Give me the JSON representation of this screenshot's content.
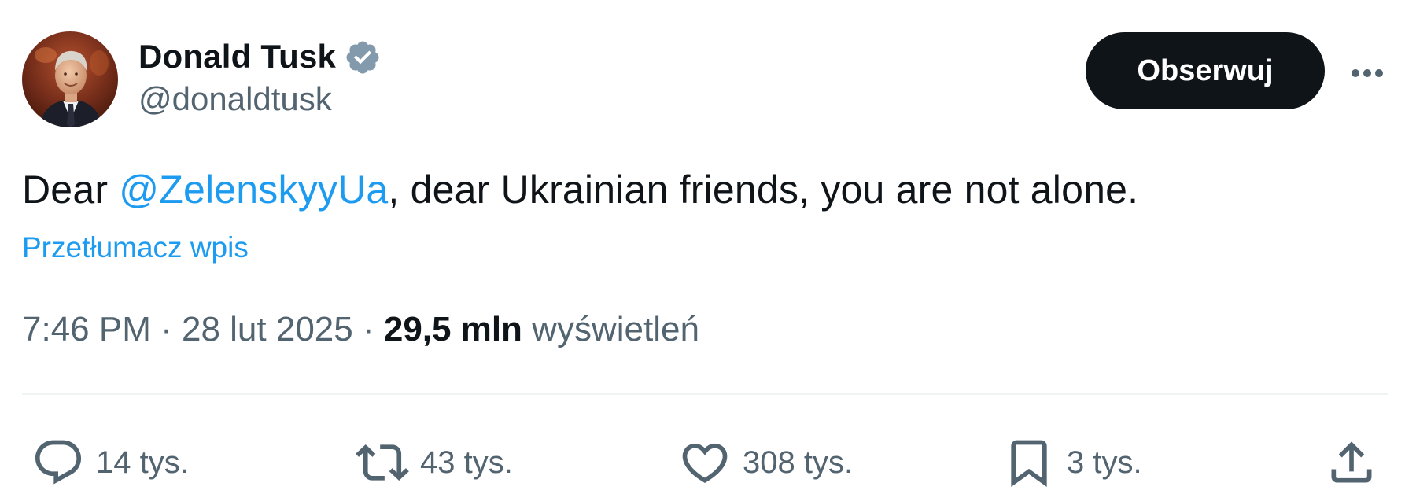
{
  "author": {
    "display_name": "Donald Tusk",
    "handle": "@donaldtusk",
    "verified_icon": "verified-badge-icon",
    "verified_color": "#829aab"
  },
  "header": {
    "follow_label": "Obserwuj",
    "more_icon": "more-options-icon"
  },
  "tweet": {
    "text_before": "Dear ",
    "mention": "@ZelenskyyUa",
    "text_after": ", dear Ukrainian friends, you are not alone.",
    "translate_label": "Przetłumacz wpis"
  },
  "meta": {
    "time": "7:46 PM",
    "date": "28 lut 2025",
    "separator": " · ",
    "views_count": "29,5 mln",
    "views_label": "wyświetleń"
  },
  "actions": {
    "reply": {
      "icon": "reply-icon",
      "count": "14 tys."
    },
    "retweet": {
      "icon": "retweet-icon",
      "count": "43 tys."
    },
    "like": {
      "icon": "heart-icon",
      "count": "308 tys."
    },
    "bookmark": {
      "icon": "bookmark-icon",
      "count": "3 tys."
    },
    "share": {
      "icon": "share-icon"
    }
  },
  "colors": {
    "text_primary": "#0f1419",
    "text_secondary": "#536471",
    "link": "#1d9bf0",
    "button_bg": "#0f1419",
    "divider": "#eff3f4"
  }
}
